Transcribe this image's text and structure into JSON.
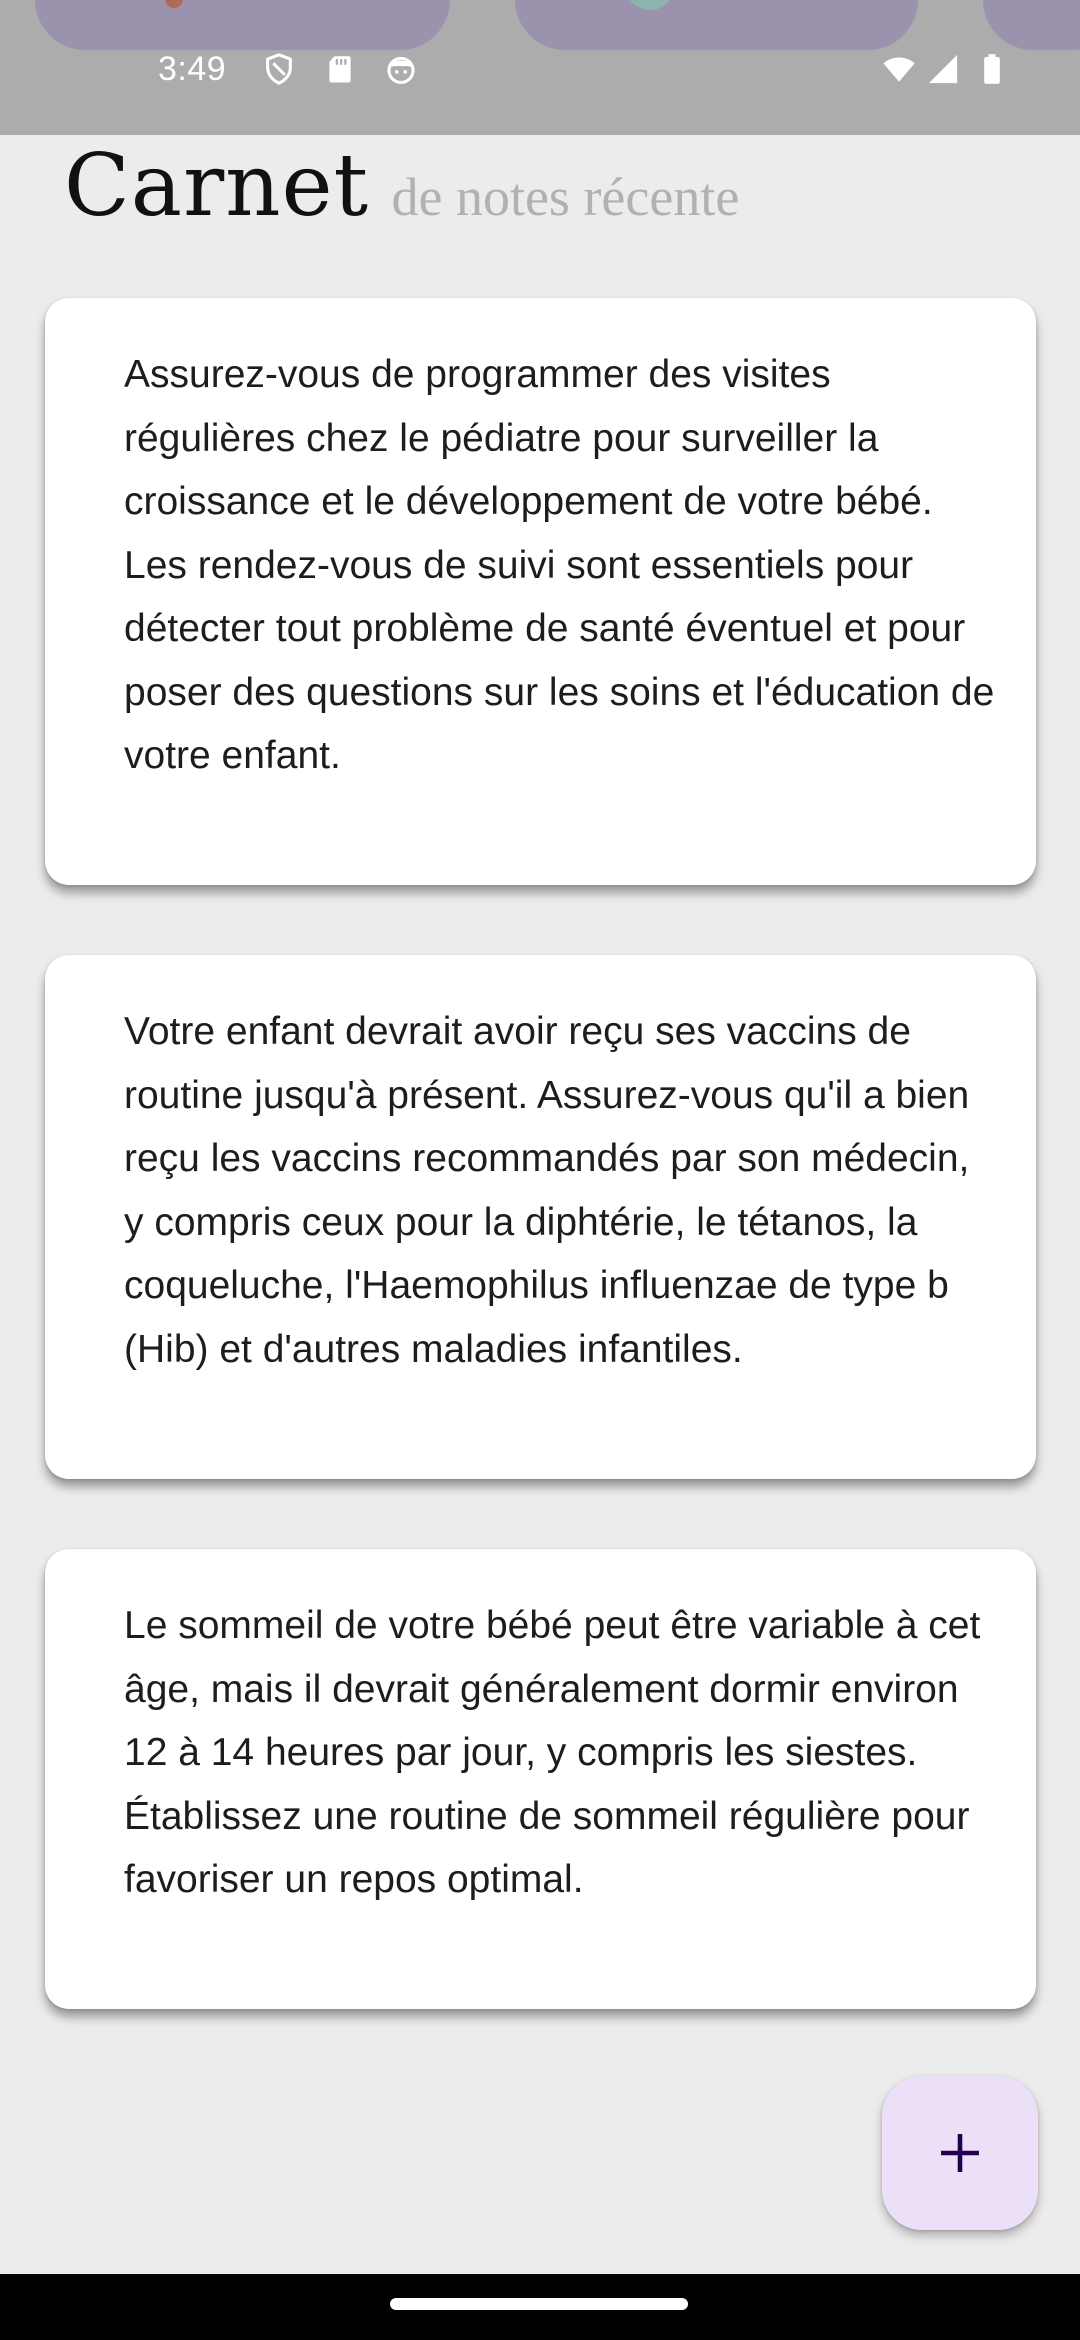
{
  "status_bar": {
    "time": "3:49",
    "icons": [
      "shield-icon",
      "sd-card-icon",
      "face-icon",
      "wifi-icon",
      "cellular-icon",
      "battery-icon"
    ]
  },
  "header": {
    "title": "Carnet",
    "subtitle": "de notes récente"
  },
  "notes": [
    {
      "text": "Assurez-vous de programmer des visites régulières chez le pédiatre pour surveiller la croissance et le développement de votre bébé. Les rendez-vous de suivi sont essentiels pour détecter tout problème de santé éventuel et pour poser des questions sur les soins et l'éducation de votre enfant."
    },
    {
      "text": "Votre enfant devrait avoir reçu ses vaccins de routine jusqu'à présent. Assurez-vous qu'il a bien reçu les vaccins recommandés par son médecin, y compris ceux pour la diphtérie, le tétanos, la coqueluche, l'Haemophilus influenzae de type b (Hib) et d'autres maladies infantiles."
    },
    {
      "text": "Le sommeil de votre bébé peut être variable à cet âge, mais il devrait généralement dormir environ 12 à 14 heures par jour, y compris les siestes. Établissez une routine de sommeil régulière pour favoriser un repos optimal."
    }
  ],
  "fab": {
    "icon": "plus-icon"
  },
  "colors": {
    "background": "#ececec",
    "status_scrim": "#acacac",
    "card": "#ffffff",
    "fab_bg": "#ece0f9",
    "fab_icon": "#22004d",
    "title": "#111111",
    "subtitle": "#b1b1b1"
  }
}
